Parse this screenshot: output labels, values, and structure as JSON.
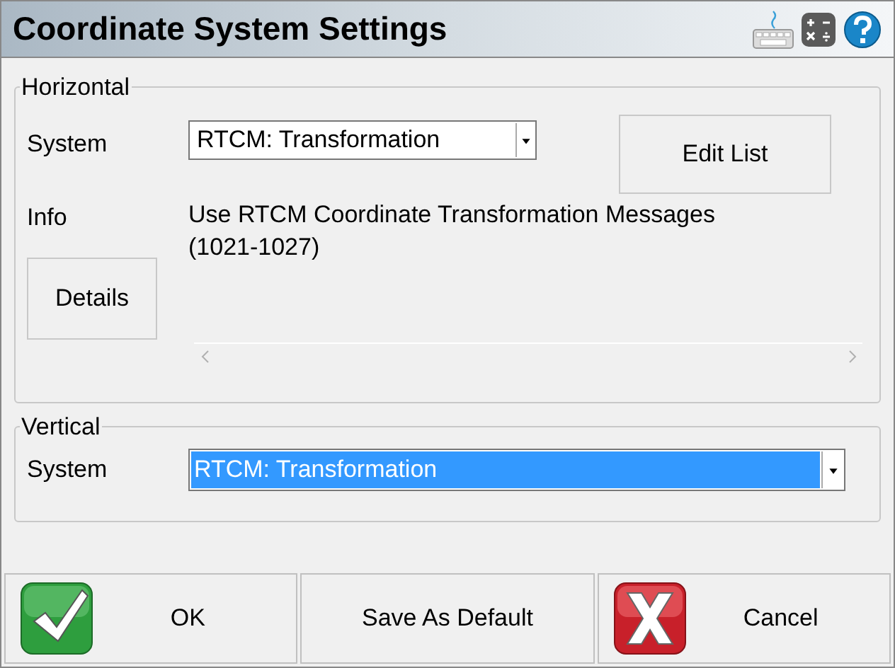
{
  "window": {
    "title": "Coordinate System Settings"
  },
  "horizontal": {
    "legend": "Horizontal",
    "system_label": "System",
    "system": {
      "value": "RTCM: Transformation",
      "highlighted": false
    },
    "edit_list_button": "Edit List",
    "info_label": "Info",
    "info": "Use RTCM Coordinate Transformation Messages (1021-1027)",
    "details_button": "Details"
  },
  "vertical": {
    "legend": "Vertical",
    "system_label": "System",
    "system": {
      "value": "RTCM: Transformation",
      "highlighted": true
    }
  },
  "buttons": [
    {
      "kind": "ok",
      "label": "OK"
    },
    {
      "kind": "plain",
      "label": "Save As Default"
    },
    {
      "kind": "cancel",
      "label": "Cancel"
    }
  ]
}
